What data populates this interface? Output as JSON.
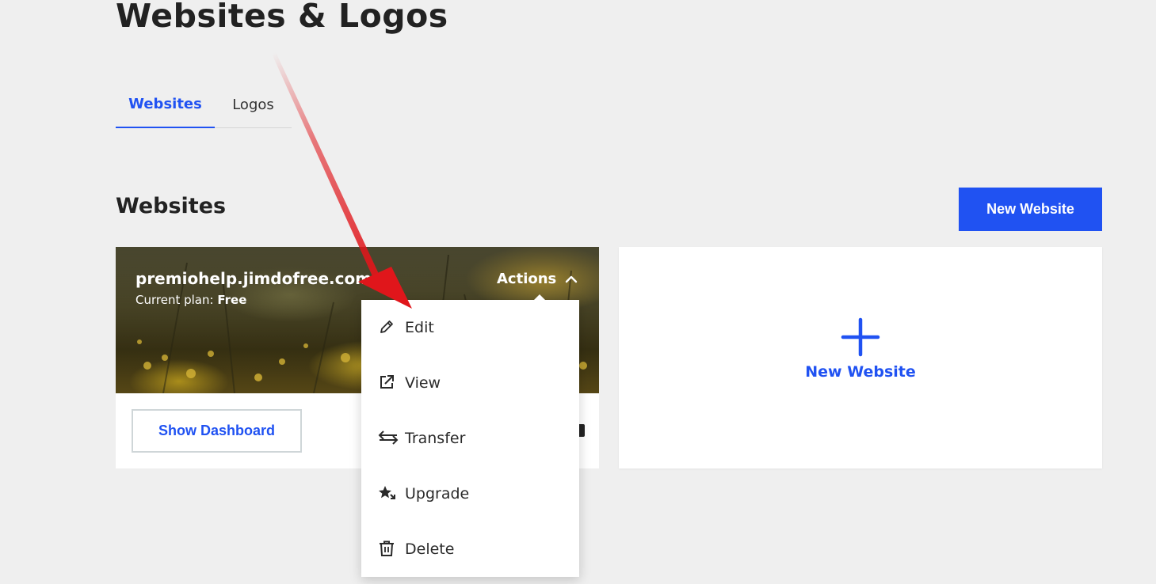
{
  "page": {
    "title": "Websites & Logos"
  },
  "tabs": [
    {
      "label": "Websites",
      "active": true
    },
    {
      "label": "Logos",
      "active": false
    }
  ],
  "section": {
    "title": "Websites",
    "new_button": "New Website"
  },
  "site_card": {
    "domain": "premiohelp.jimdofree.com",
    "plan_label": "Current plan:",
    "plan_value": "Free",
    "actions_label": "Actions",
    "dashboard_button": "Show Dashboard"
  },
  "actions_menu": {
    "items": [
      {
        "label": "Edit",
        "icon": "pencil-icon"
      },
      {
        "label": "View",
        "icon": "external-link-icon"
      },
      {
        "label": "Transfer",
        "icon": "transfer-arrows-icon"
      },
      {
        "label": "Upgrade",
        "icon": "upgrade-star-icon"
      },
      {
        "label": "Delete",
        "icon": "trash-icon"
      }
    ]
  },
  "new_site_card": {
    "label": "New Website",
    "icon": "plus-icon"
  },
  "colors": {
    "accent": "#2052f2",
    "background": "#efefef",
    "annotation_arrow": "#e0161b"
  }
}
